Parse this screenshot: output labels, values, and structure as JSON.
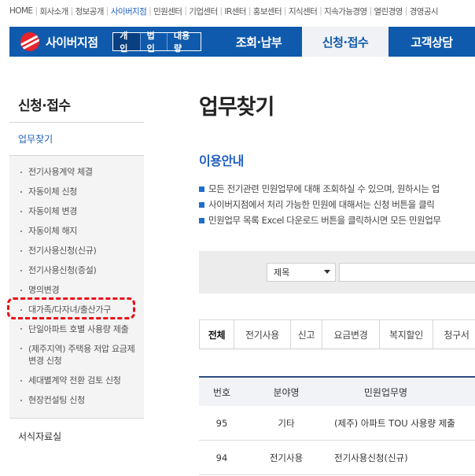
{
  "top_nav": {
    "items": [
      "HOME",
      "회사소개",
      "정보공개",
      "사이버지점",
      "민원센터",
      "기업센터",
      "IR센터",
      "홍보센터",
      "지식센터",
      "지속가능경영",
      "열린경영",
      "경영공시"
    ],
    "active": "사이버지점"
  },
  "header": {
    "brand": "사이버지점",
    "segments": [
      "개인",
      "법인",
      "대용량"
    ],
    "menu": [
      "조회·납부",
      "신청·접수",
      "고객상담"
    ]
  },
  "sidebar": {
    "title": "신청·접수",
    "current": "업무찾기",
    "items": [
      "전기사용계약 체결",
      "자동이체 신청",
      "자동이체 변경",
      "자동이체 해지",
      "전기사용신청(신규)",
      "전기사용신청(증설)",
      "명의변경",
      "대가족/다자녀/출산가구",
      "단일아파트 호별 사용량 제출",
      "(제주지역) 주택용 저압 요금제 변경 신청",
      "세대별계약 전환 검토 신청",
      "현장컨설팅 신청"
    ],
    "bottom": "서식자료실"
  },
  "main": {
    "title": "업무찾기",
    "section_title": "이용안내",
    "info": [
      "모든 전기관련 민원업무에 대해 조회하실 수 있으며, 원하시는 업",
      "사이버지점에서 처리 가능한 민원에 대해서는 신청 버튼을 클릭",
      "민원업무 목록 Excel 다운로드 버튼을 클릭하시면 모든 민원업무"
    ],
    "search": {
      "select_value": "제목"
    },
    "tabs": [
      "전체",
      "전기사용",
      "신고",
      "요금변경",
      "복지할인",
      "청구서"
    ],
    "table": {
      "headers": [
        "번호",
        "분야명",
        "민원업무명"
      ],
      "rows": [
        [
          "95",
          "기타",
          "(제주) 아파트 TOU 사용량 제출"
        ],
        [
          "94",
          "전기사용",
          "전기사용신청(신규)"
        ]
      ]
    }
  },
  "colors": {
    "header_blue": "#0f5aac",
    "link_blue": "#1f5fbf",
    "highlight_red": "#e8101a"
  }
}
